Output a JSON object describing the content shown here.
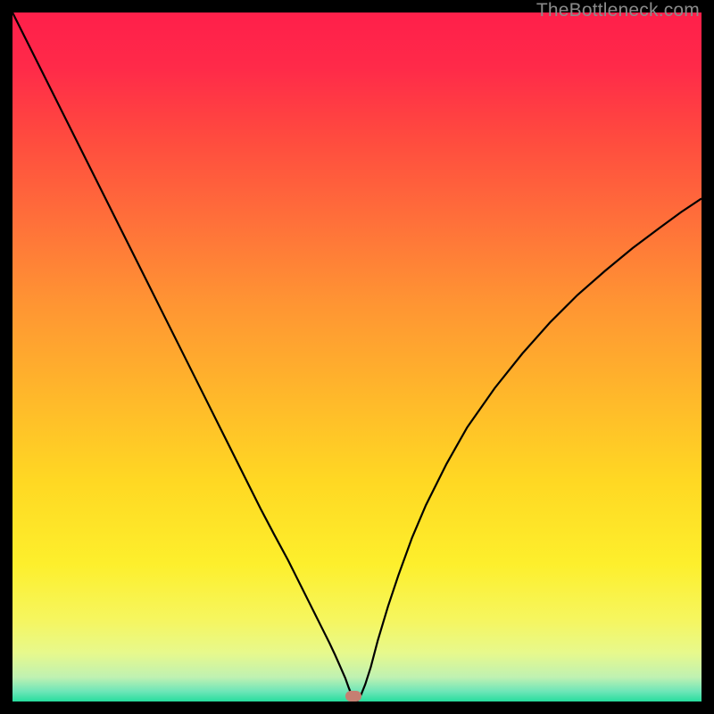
{
  "watermark": "TheBottleneck.com",
  "marker": {
    "x_frac": 0.495,
    "y_frac": 0.992
  },
  "chart_data": {
    "type": "line",
    "title": "",
    "xlabel": "",
    "ylabel": "",
    "xlim": [
      0,
      1
    ],
    "ylim": [
      0,
      1
    ],
    "background": {
      "type": "vertical-gradient",
      "stops": [
        {
          "pos": 0.0,
          "color": "#ff1f4a"
        },
        {
          "pos": 0.08,
          "color": "#ff2a49"
        },
        {
          "pos": 0.18,
          "color": "#ff4a3f"
        },
        {
          "pos": 0.3,
          "color": "#ff6f3a"
        },
        {
          "pos": 0.42,
          "color": "#ff9433"
        },
        {
          "pos": 0.55,
          "color": "#ffb62b"
        },
        {
          "pos": 0.68,
          "color": "#ffd823"
        },
        {
          "pos": 0.8,
          "color": "#fdef2c"
        },
        {
          "pos": 0.88,
          "color": "#f6f65e"
        },
        {
          "pos": 0.93,
          "color": "#e7f98d"
        },
        {
          "pos": 0.965,
          "color": "#bff1b2"
        },
        {
          "pos": 0.985,
          "color": "#6fe6b8"
        },
        {
          "pos": 1.0,
          "color": "#27dd9e"
        }
      ]
    },
    "series": [
      {
        "name": "bottleneck-curve",
        "color": "#000000",
        "x": [
          0.0,
          0.02,
          0.04,
          0.06,
          0.08,
          0.1,
          0.12,
          0.14,
          0.16,
          0.18,
          0.2,
          0.22,
          0.24,
          0.26,
          0.28,
          0.3,
          0.32,
          0.34,
          0.36,
          0.38,
          0.4,
          0.41,
          0.42,
          0.43,
          0.44,
          0.45,
          0.46,
          0.468,
          0.476,
          0.483,
          0.488,
          0.492,
          0.495,
          0.5,
          0.506,
          0.512,
          0.52,
          0.53,
          0.545,
          0.56,
          0.58,
          0.6,
          0.63,
          0.66,
          0.7,
          0.74,
          0.78,
          0.82,
          0.86,
          0.9,
          0.94,
          0.97,
          1.0
        ],
        "y": [
          1.0,
          0.96,
          0.92,
          0.88,
          0.84,
          0.8,
          0.76,
          0.72,
          0.68,
          0.64,
          0.6,
          0.56,
          0.52,
          0.48,
          0.44,
          0.4,
          0.36,
          0.32,
          0.28,
          0.242,
          0.205,
          0.185,
          0.165,
          0.145,
          0.125,
          0.105,
          0.085,
          0.068,
          0.05,
          0.034,
          0.02,
          0.01,
          0.0,
          0.0,
          0.01,
          0.025,
          0.05,
          0.088,
          0.138,
          0.183,
          0.238,
          0.285,
          0.345,
          0.398,
          0.455,
          0.505,
          0.55,
          0.59,
          0.625,
          0.658,
          0.688,
          0.71,
          0.73
        ]
      }
    ],
    "markers": [
      {
        "name": "optimum-point",
        "x": 0.495,
        "y": 0.0,
        "color": "#c57f72",
        "shape": "pill"
      }
    ]
  }
}
